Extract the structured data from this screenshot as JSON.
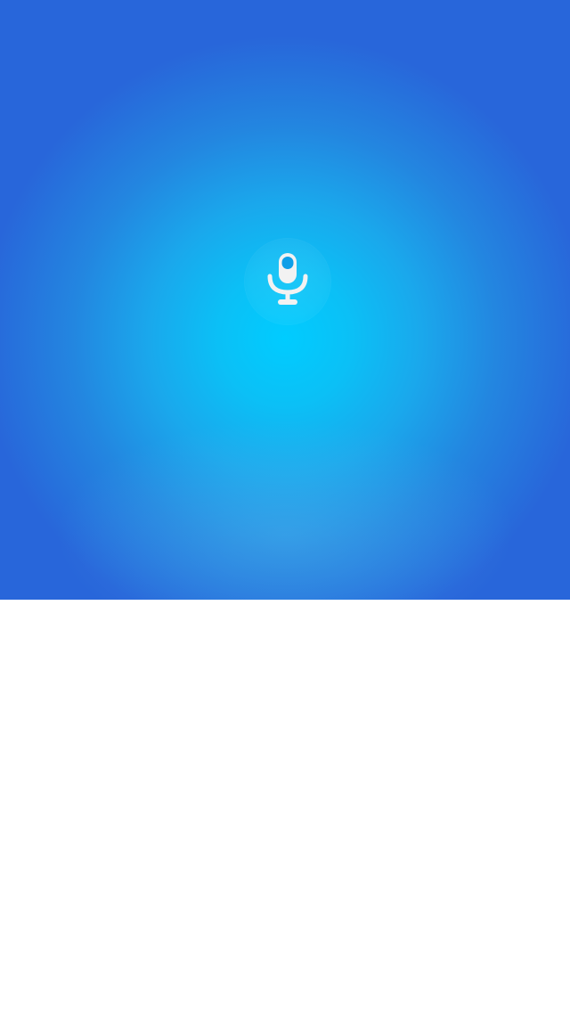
{
  "voice_panel": {
    "gradient_center_color": "#00ccff",
    "gradient_edge_color": "#2866da",
    "mic_icon": "microphone-icon",
    "mic_icon_color": "#f2f2f2",
    "hint_text": ""
  },
  "content_area": {
    "background_color": "#ffffff"
  }
}
